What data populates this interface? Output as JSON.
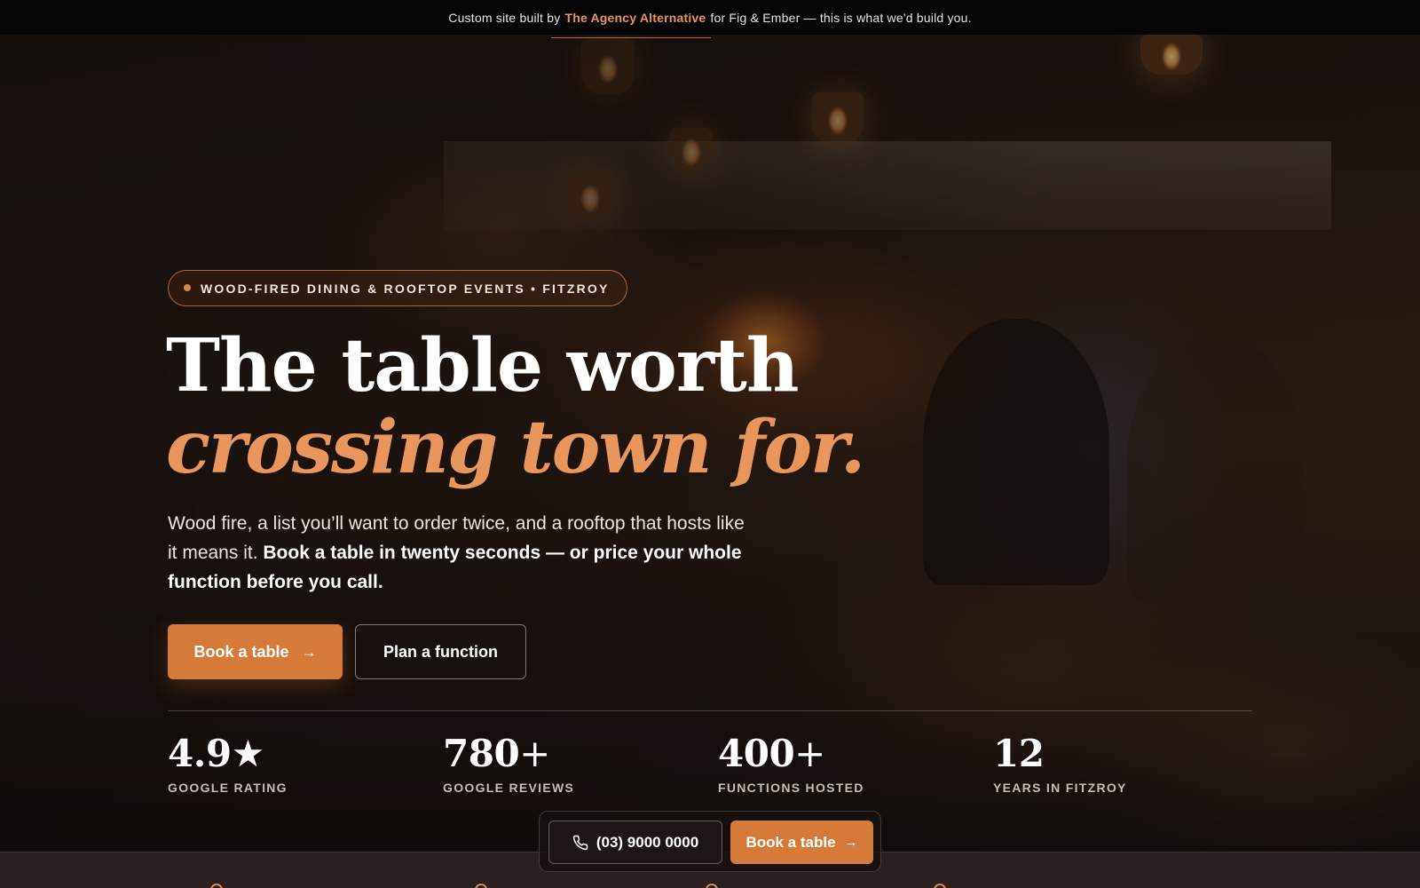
{
  "topbar": {
    "prefix": "Custom site built by",
    "agency": "The Agency Alternative",
    "suffix": "for Fig & Ember — this is what we'd build you."
  },
  "hero": {
    "badge": "WOOD-FIRED DINING & ROOFTOP EVENTS • FITZROY",
    "headline_line1": "The table worth",
    "headline_line2": "crossing town for.",
    "subtitle_plain": "Wood fire, a list you’ll want to order twice, and a rooftop that hosts like it means it.",
    "subtitle_bold": "Book a table in twenty seconds — or price your whole function before you call.",
    "primary_cta": "Book a table",
    "secondary_cta": "Plan a function"
  },
  "stats": [
    {
      "value": "4.9",
      "suffix": "★",
      "label": "GOOGLE RATING"
    },
    {
      "value": "780",
      "suffix": "+",
      "label": "GOOGLE REVIEWS"
    },
    {
      "value": "400",
      "suffix": "+",
      "label": "FUNCTIONS HOSTED"
    },
    {
      "value": "12",
      "suffix": "",
      "label": "YEARS IN FITZROY"
    }
  ],
  "floating_bar": {
    "phone": "(03) 9000 0000",
    "book_label": "Book a table"
  },
  "icons": {
    "arrow": "arrow-right-icon",
    "phone": "phone-icon",
    "badge_dot": "dot-icon"
  },
  "colors": {
    "accent": "#d67a3a",
    "accent_text": "#e8965b",
    "background": "#120d0b",
    "topbar": "#050505"
  }
}
